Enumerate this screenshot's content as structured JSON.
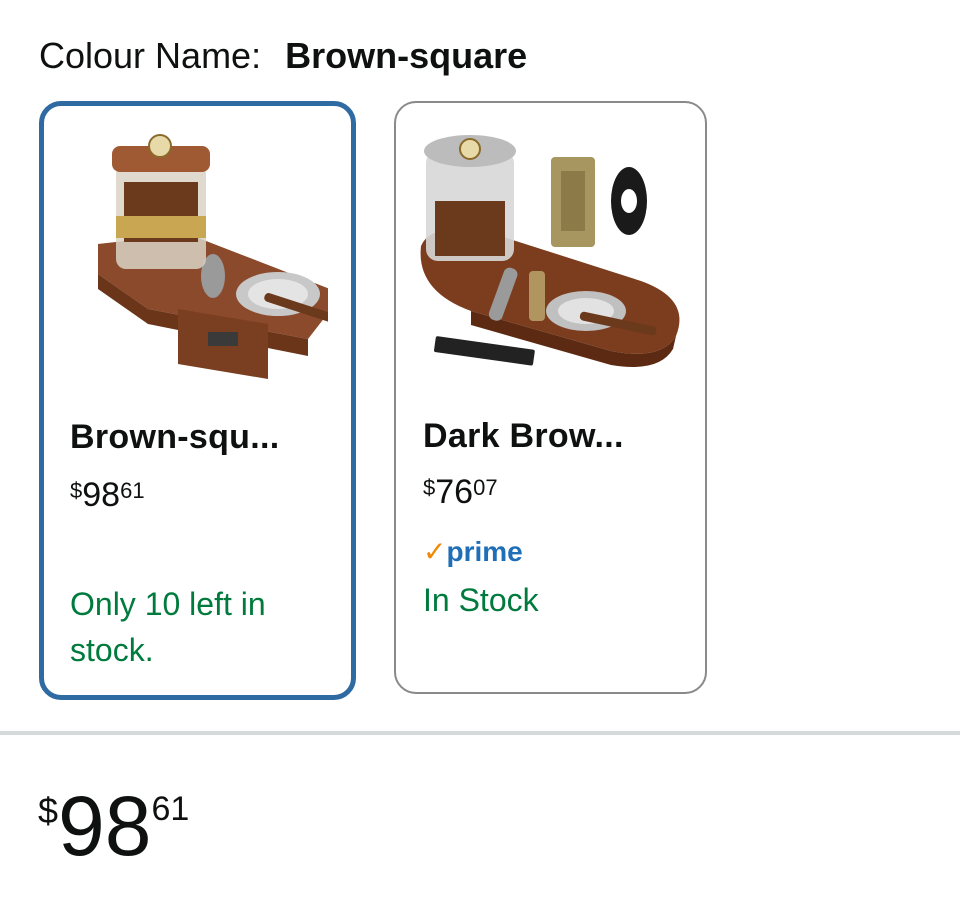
{
  "colour": {
    "label": "Colour Name:",
    "value": "Brown-square"
  },
  "options": [
    {
      "title": "Brown-squ...",
      "price_symbol": "$",
      "price_whole": "98",
      "price_fraction": "61",
      "prime": false,
      "stock": "Only 10 left in stock.",
      "selected": true,
      "image_icon": "humidor-square-ashtray-image"
    },
    {
      "title": "Dark Brow...",
      "price_symbol": "$",
      "price_whole": "76",
      "price_fraction": "07",
      "prime": true,
      "prime_check": "✓",
      "prime_word": "prime",
      "stock": "In Stock",
      "selected": false,
      "image_icon": "humidor-oval-ashtray-set-image"
    }
  ],
  "price": {
    "symbol": "$",
    "whole": "98",
    "fraction": "61"
  },
  "colors": {
    "selected_border": "#2f6aa3",
    "stock_green": "#007a3d",
    "prime_blue": "#1f6fb8",
    "prime_orange": "#f08804"
  }
}
